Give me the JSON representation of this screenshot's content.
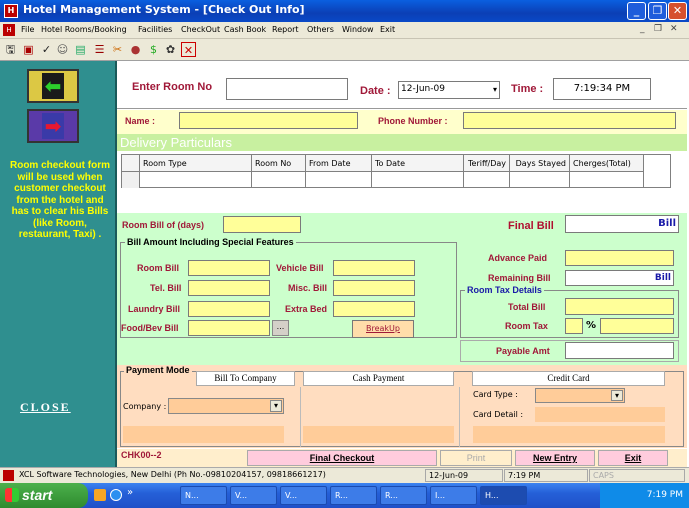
{
  "window": {
    "title": "Hotel Management System - [Check Out Info]"
  },
  "menu": [
    "File",
    "Hotel Rooms/Booking",
    "Facilities",
    "CheckOut",
    "Cash Book",
    "Report",
    "Others",
    "Window",
    "Exit"
  ],
  "toolbar_icons": [
    "save-icon",
    "form-icon",
    "check-icon",
    "guest-icon",
    "room-icon",
    "list-icon",
    "tools-icon",
    "booking-icon",
    "money-icon",
    "service-icon",
    "cancel-icon"
  ],
  "sidebar": {
    "description": "Room checkout form will be used when customer checkout from the hotel and has to clear his Bills (like Room, restaurant, Taxi) .",
    "close_label": "CLOSE"
  },
  "header": {
    "room_label": "Enter Room No",
    "room_value": "",
    "date_label": "Date :",
    "date_value": "12-Jun-09",
    "time_label": "Time :",
    "time_value": "7:19:34 PM",
    "name_label": "Name :",
    "phone_label": "Phone Number :"
  },
  "delivery": {
    "title": "Delivery Particulars",
    "columns": [
      "Room Type",
      "Room No",
      "From Date",
      "To Date",
      "Teriff/Day",
      "Days Stayed",
      "Cherges(Total)"
    ]
  },
  "bill": {
    "room_bill_days_label": "Room Bill of (days)",
    "final_bill_label": "Final Bill",
    "final_bill_value": "Bill",
    "special_title": "Bill Amount Including Special Features",
    "room_bill": "Room Bill",
    "vehicle_bill": "Vehicle Bill",
    "tel_bill": "Tel. Bill",
    "misc_bill": "Misc. Bill",
    "laundry_bill": "Laundry Bill",
    "extra_bed": "Extra Bed",
    "food_bill": "Food/Bev Bill",
    "ellipsis": "...",
    "breakup": "BreakUp",
    "advance_paid": "Advance Paid",
    "remaining_bill": "Remaining Bill",
    "remaining_value": "Bill",
    "room_tax_details": "Room Tax Details",
    "total_bill": "Total Bill",
    "room_tax": "Room Tax",
    "percent": "%",
    "payable_amt": "Payable Amt"
  },
  "payment": {
    "title": "Payment Mode",
    "bill_to_company": "Bill To Company",
    "cash_payment": "Cash Payment",
    "credit_card": "Credit Card",
    "company_label": "Company :",
    "card_type_label": "Card Type :",
    "card_detail_label": "Card Detail :"
  },
  "actions": {
    "checkout_id": "CHK00--2",
    "final_checkout": "Final Checkout",
    "print": "Print",
    "new_entry": "New Entry",
    "exit": "Exit"
  },
  "statusbar": {
    "company": "XCL Software Technologies, New Delhi (Ph No.-09810204157, 09818661217)",
    "date": "12-Jun-09",
    "time": "7:19 PM",
    "caps": "CAPS"
  },
  "taskbar": {
    "start": "start",
    "tasks": [
      "N...",
      "V...",
      "V...",
      "R...",
      "R...",
      "I...",
      "H..."
    ],
    "clock": "7:19 PM"
  }
}
